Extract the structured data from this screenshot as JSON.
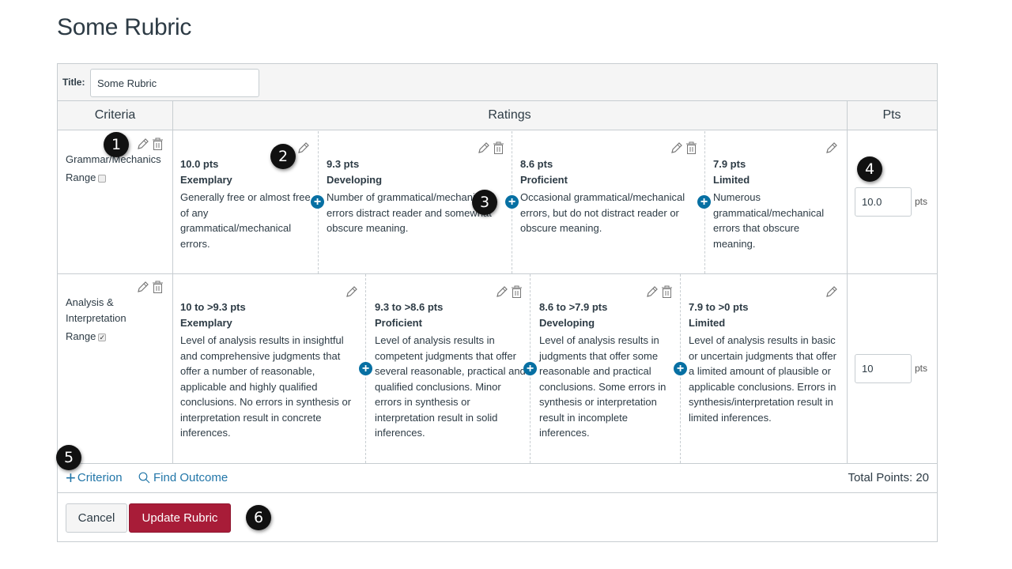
{
  "page": {
    "title": "Some Rubric"
  },
  "rubric_form": {
    "title_label": "Title:",
    "title_value": "Some Rubric",
    "headers": {
      "criteria": "Criteria",
      "ratings": "Ratings",
      "pts": "Pts"
    },
    "criteria": [
      {
        "name": "Grammar/Mechanics",
        "range_label": "Range",
        "range_checked": false,
        "points_value": "10.0",
        "points_suffix": "pts",
        "ratings": [
          {
            "pts": "10.0 pts",
            "name": "Exemplary",
            "description": "Generally free or almost free of any grammatical/mechanical errors.",
            "icons": [
              "pencil-icon"
            ]
          },
          {
            "pts": "9.3 pts",
            "name": "Developing",
            "description": "Number of grammatical/mechanical errors distract reader and somewhat obscure meaning.",
            "icons": [
              "pencil-icon",
              "trash-icon"
            ]
          },
          {
            "pts": "8.6 pts",
            "name": "Proficient",
            "description": "Occasional grammatical/mechanical errors, but do not distract reader or obscure meaning.",
            "icons": [
              "pencil-icon",
              "trash-icon"
            ]
          },
          {
            "pts": "7.9 pts",
            "name": "Limited",
            "description": "Numerous grammatical/mechanical errors that obscure meaning.",
            "icons": [
              "pencil-icon"
            ]
          }
        ]
      },
      {
        "name": "Analysis & Interpretation",
        "range_label": "Range",
        "range_checked": true,
        "points_value": "10",
        "points_suffix": "pts",
        "ratings": [
          {
            "pts": "10 to >9.3 pts",
            "name": "Exemplary",
            "description": "Level of analysis results in insightful and comprehensive judgments that offer a number of reasonable, applicable and highly qualified conclusions. No errors in synthesis or interpretation result in concrete inferences.",
            "icons": [
              "pencil-icon"
            ]
          },
          {
            "pts": "9.3 to >8.6 pts",
            "name": "Proficient",
            "description": "Level of analysis results in competent judgments that offer several reasonable, practical and qualified conclusions. Minor errors in synthesis or interpretation result in solid inferences.",
            "icons": [
              "pencil-icon",
              "trash-icon"
            ]
          },
          {
            "pts": "8.6 to >7.9 pts",
            "name": "Developing",
            "description": "Level of analysis results in judgments that offer some reasonable and practical conclusions. Some errors in synthesis or interpretation result in incomplete inferences.",
            "icons": [
              "pencil-icon",
              "trash-icon"
            ]
          },
          {
            "pts": "7.9 to >0 pts",
            "name": "Limited",
            "description": "Level of analysis results in basic or uncertain judgments that offer a limited amount of plausible or applicable conclusions. Errors in synthesis/interpretation result in limited inferences.",
            "icons": [
              "pencil-icon"
            ]
          }
        ]
      }
    ],
    "footer": {
      "add_criterion": "Criterion",
      "find_outcome": "Find Outcome",
      "total_points": "Total Points: 20"
    },
    "buttons": {
      "cancel": "Cancel",
      "update": "Update Rubric"
    }
  },
  "annotations": [
    "1",
    "2",
    "3",
    "4",
    "5",
    "6"
  ],
  "colors": {
    "primary_button": "#a81c38",
    "link": "#2276a8",
    "add_rating": "#0770a3"
  }
}
